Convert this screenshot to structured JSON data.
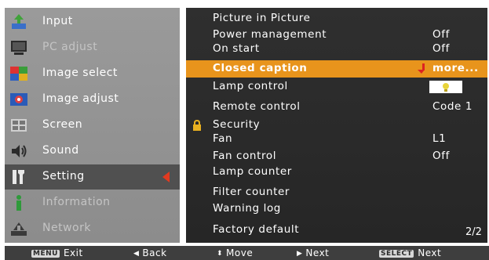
{
  "left_menu": {
    "items": [
      {
        "label": "Input",
        "icon": "input-icon",
        "dim": false,
        "selected": false
      },
      {
        "label": "PC adjust",
        "icon": "pc-adjust-icon",
        "dim": true,
        "selected": false
      },
      {
        "label": "Image select",
        "icon": "image-select-icon",
        "dim": false,
        "selected": false
      },
      {
        "label": "Image adjust",
        "icon": "image-adjust-icon",
        "dim": false,
        "selected": false
      },
      {
        "label": "Screen",
        "icon": "screen-icon",
        "dim": false,
        "selected": false
      },
      {
        "label": "Sound",
        "icon": "sound-icon",
        "dim": false,
        "selected": false
      },
      {
        "label": "Setting",
        "icon": "setting-icon",
        "dim": false,
        "selected": true
      },
      {
        "label": "Information",
        "icon": "information-icon",
        "dim": true,
        "selected": false
      },
      {
        "label": "Network",
        "icon": "network-icon",
        "dim": true,
        "selected": false
      }
    ]
  },
  "settings": {
    "rows": [
      {
        "label": "Picture in Picture",
        "value": ""
      },
      {
        "label": "Power management",
        "value": "Off"
      },
      {
        "label": "On start",
        "value": "Off"
      },
      {
        "label": "Closed caption",
        "value": "more..."
      },
      {
        "label": "Lamp control",
        "value": ""
      },
      {
        "label": "Remote control",
        "value": "Code 1"
      },
      {
        "label": "Security",
        "value": ""
      },
      {
        "label": "Fan",
        "value": "L1"
      },
      {
        "label": "Fan control",
        "value": "Off"
      },
      {
        "label": "Lamp counter",
        "value": ""
      },
      {
        "label": "Filter counter",
        "value": ""
      },
      {
        "label": "Warning log",
        "value": ""
      },
      {
        "label": "Factory default",
        "value": ""
      }
    ],
    "page": "2/2"
  },
  "bottom_bar": {
    "menu_key": "MENU",
    "exit": "Exit",
    "back": "Back",
    "move": "Move",
    "next": "Next",
    "select_key": "SELECT",
    "select_next": "Next"
  },
  "colors": {
    "highlight": "#e8941c",
    "arrow": "#e23a20"
  }
}
